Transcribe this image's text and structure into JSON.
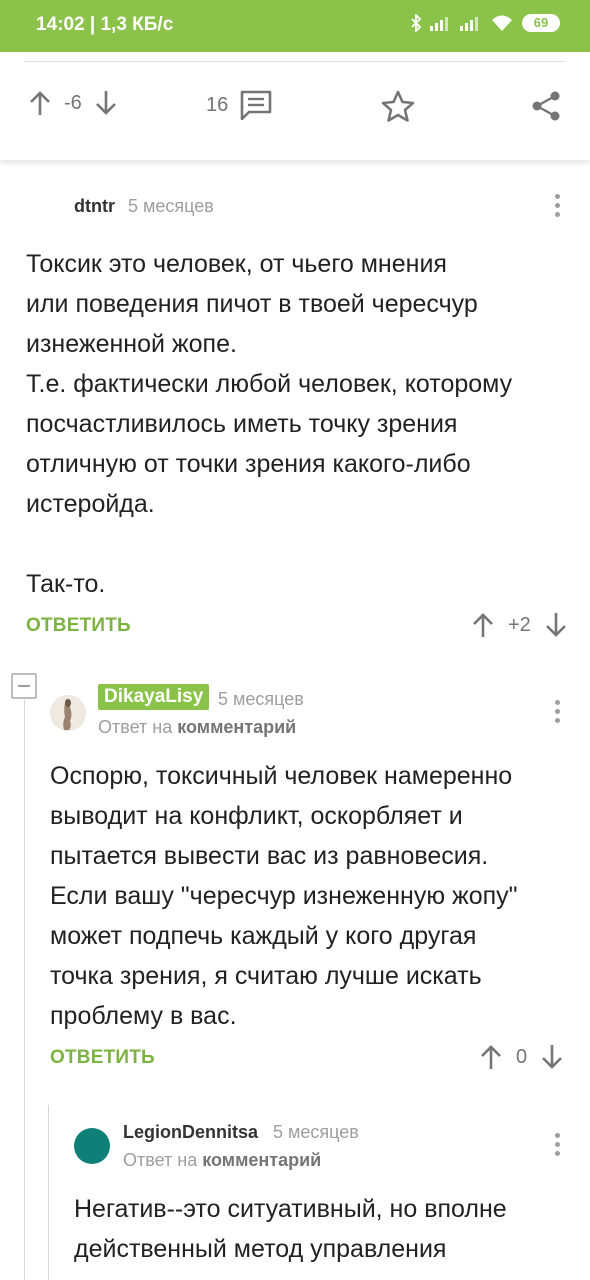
{
  "statusbar": {
    "time": "14:02 | 1,3 КБ/с",
    "battery": "69"
  },
  "post_actions": {
    "rating": "-6",
    "comments_count": "16"
  },
  "comments": [
    {
      "author": "dtntr",
      "time": "5 месяцев",
      "text": "Токсик это человек, от чьего мнения\nили поведения пичот в твоей чересчур\nизнеженной жопе.\nТ.е. фактически любой человек, которому\nпосчастливилось иметь точку зрения\nотличную от точки  зрения какого-либо\nистеройда.\n\nТак-то.",
      "reply_label": "ОТВЕТИТЬ",
      "rating": "+2"
    },
    {
      "author": "DikayaLisy",
      "time": "5 месяцев",
      "reply_to_prefix": "Ответ на",
      "reply_to_target": "комментарий",
      "text": "Оспорю, токсичный человек намеренно\nвыводит на конфликт, оскорбляет и\nпытается вывести вас из равновесия.\nЕсли вашу \"чересчур изнеженную жопу\"\nможет подпечь каждый у кого другая\nточка зрения, я считаю лучше искать\nпроблему в вас.",
      "reply_label": "ОТВЕТИТЬ",
      "rating": "0"
    },
    {
      "author": "LegionDennitsa",
      "time": "5 месяцев",
      "reply_to_prefix": "Ответ на",
      "reply_to_target": "комментарий",
      "text": "Негатив--это ситуативный, но вполне\nдейственный метод управления"
    }
  ],
  "colors": {
    "accent": "#8bc34a",
    "reply_button": "#7cb342",
    "avatar_teal": "#0e8078"
  },
  "icons": [
    "arrow-up-icon",
    "arrow-down-icon",
    "comments-icon",
    "star-icon",
    "share-icon",
    "more-vert-icon",
    "collapse-icon"
  ]
}
